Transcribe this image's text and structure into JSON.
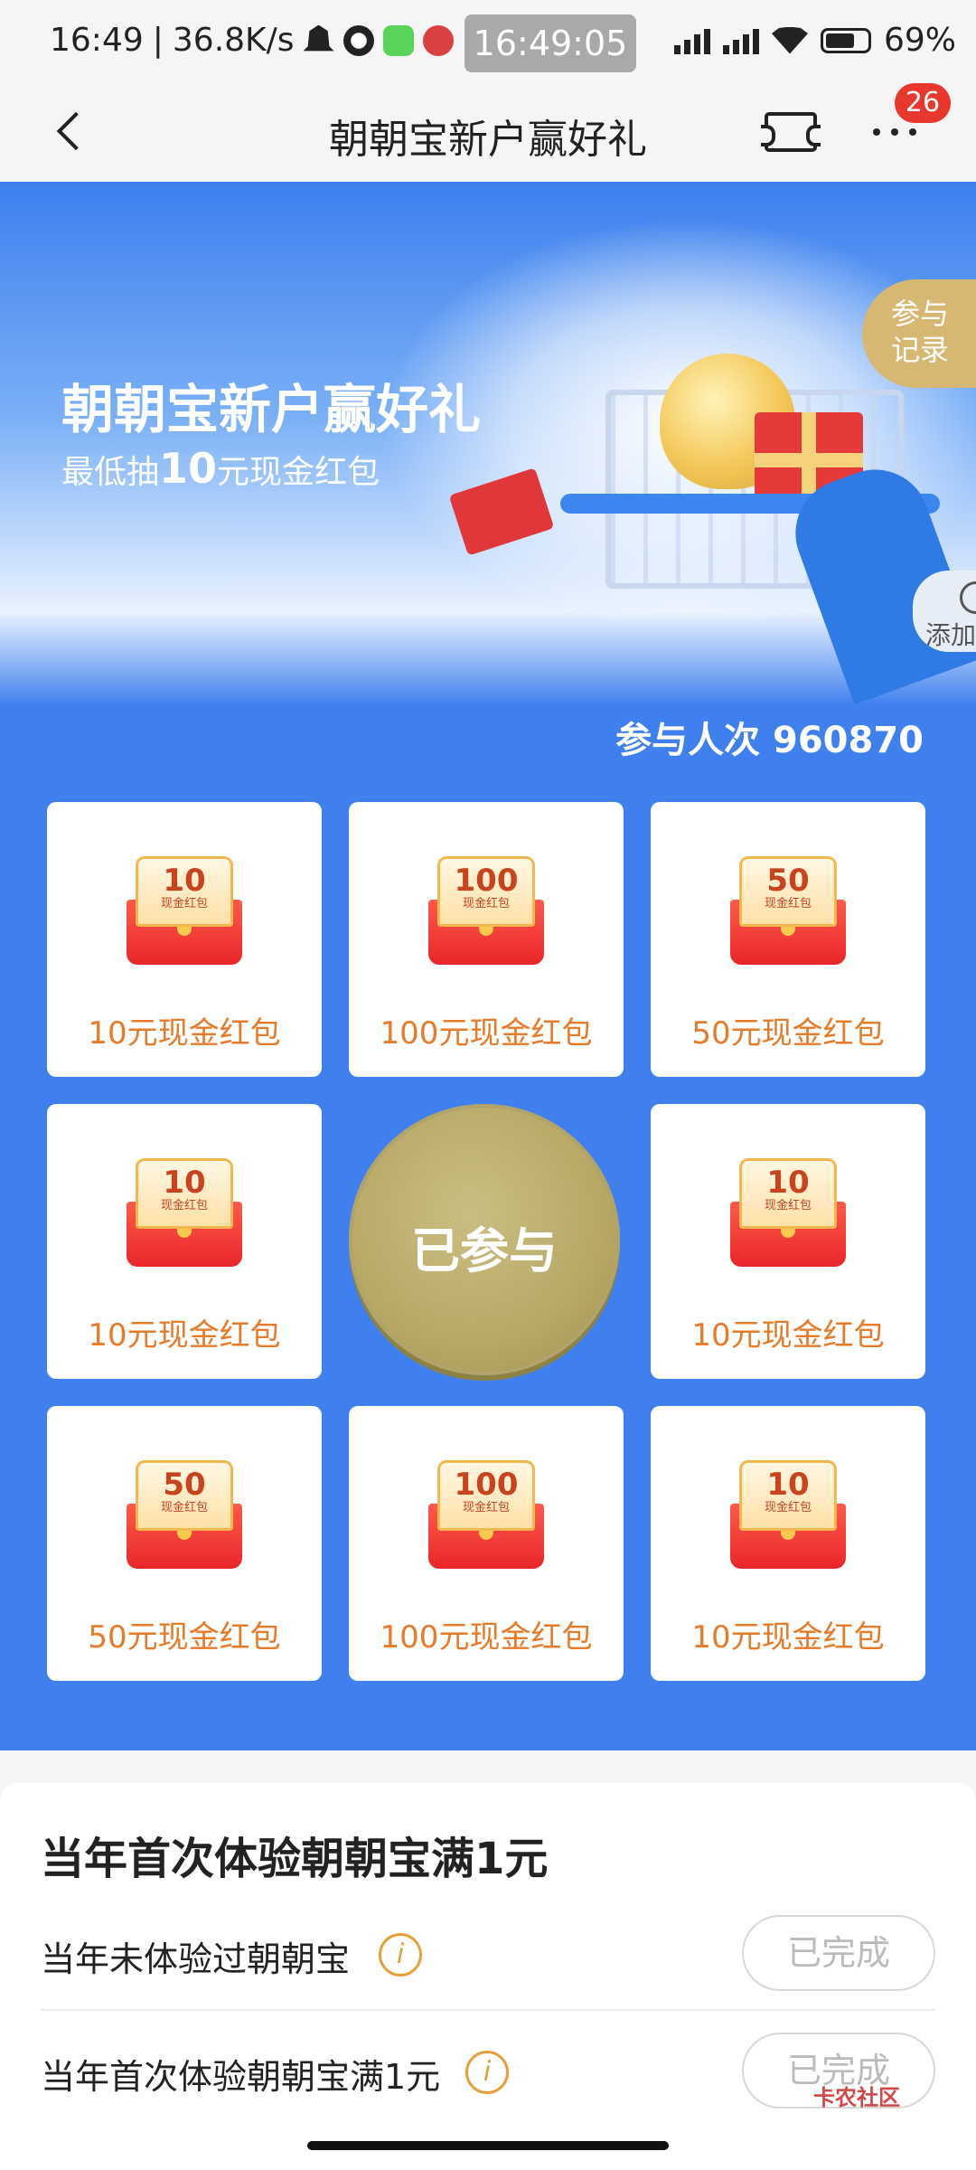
{
  "status_bar": {
    "time": "16:49",
    "net_speed": "36.8K/s",
    "center_time": "16:49:05",
    "battery": "69%"
  },
  "header": {
    "title": "朝朝宝新户赢好礼",
    "notification_count": "26"
  },
  "banner": {
    "title": "朝朝宝新户赢好礼",
    "subtitle_prefix": "最低抽",
    "subtitle_amount": "10",
    "subtitle_suffix": "元现金红包",
    "record_label_line1": "参与",
    "record_label_line2": "记录",
    "add_label": "添加"
  },
  "participants": {
    "label": "参与人次",
    "count": "960870"
  },
  "prizes": [
    {
      "amount": "10",
      "caption": "现金红包",
      "label": "10元现金红包"
    },
    {
      "amount": "100",
      "caption": "现金红包",
      "label": "100元现金红包"
    },
    {
      "amount": "50",
      "caption": "现金红包",
      "label": "50元现金红包"
    },
    {
      "amount": "10",
      "caption": "现金红包",
      "label": "10元现金红包"
    },
    {
      "amount": "10",
      "caption": "现金红包",
      "label": "10元现金红包"
    },
    {
      "amount": "50",
      "caption": "现金红包",
      "label": "50元现金红包"
    },
    {
      "amount": "100",
      "caption": "现金红包",
      "label": "100元现金红包"
    },
    {
      "amount": "10",
      "caption": "现金红包",
      "label": "10元现金红包"
    }
  ],
  "center_button": {
    "label": "已参与"
  },
  "tasks": {
    "title": "当年首次体验朝朝宝满1元",
    "items": [
      {
        "label": "当年未体验过朝朝宝",
        "status": "已完成"
      },
      {
        "label": "当年首次体验朝朝宝满1元",
        "status": "已完成"
      }
    ]
  },
  "watermark": "卡农社区",
  "colors": {
    "campaign_blue": "#3f80ee",
    "prize_label": "#e77b2a",
    "badge_red": "#e8372c",
    "center_button_gold": "#b8a866"
  }
}
